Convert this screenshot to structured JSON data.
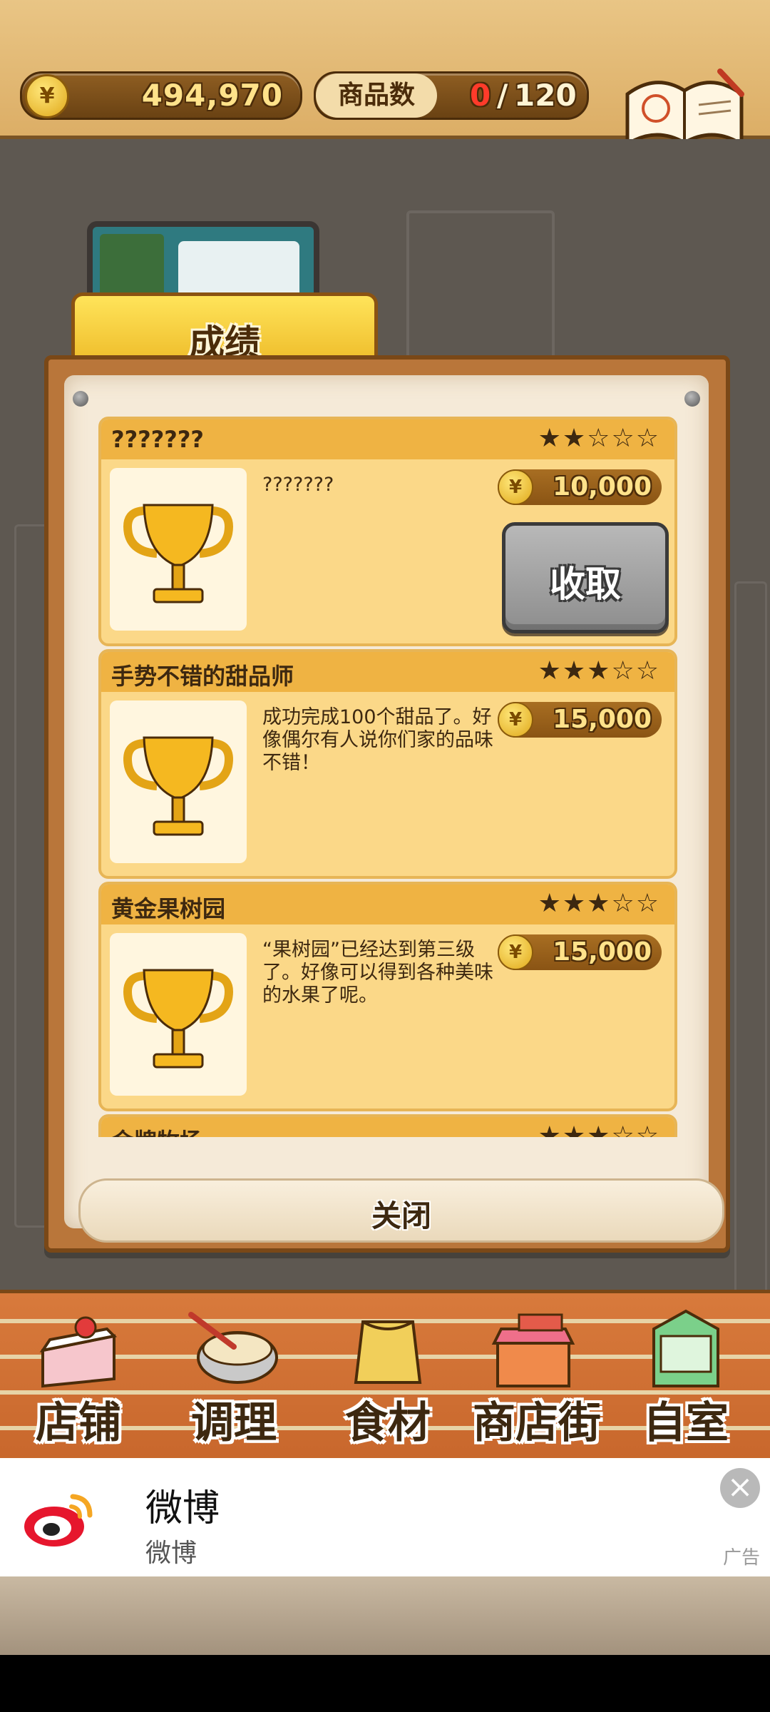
{
  "topbar": {
    "money_icon": "¥",
    "money": "494,970",
    "count_label": "商品数",
    "count_current": "0",
    "count_separator": "/",
    "count_max": "120",
    "recipe_label": "食谱",
    "recipe_icon": "recipe-book-icon"
  },
  "dialog": {
    "tab_title": "成绩",
    "close_label": "关闭",
    "achievements": [
      {
        "title": "???????",
        "stars": "★★☆☆☆",
        "rating": 2,
        "description": "???????",
        "reward_icon": "¥",
        "reward": "10,000",
        "claim_label": "收取",
        "icon": "trophy-icon"
      },
      {
        "title": "手势不错的甜品师",
        "stars": "★★★☆☆",
        "rating": 3,
        "description": "成功完成100个甜品了。好像偶尔有人说你们家的品味不错！",
        "reward_icon": "¥",
        "reward": "15,000",
        "icon": "trophy-icon"
      },
      {
        "title": "黄金果树园",
        "stars": "★★★☆☆",
        "rating": 3,
        "description": "“果树园”已经达到第三级了。好像可以得到各种美味的水果了呢。",
        "reward_icon": "¥",
        "reward": "15,000",
        "icon": "trophy-icon"
      },
      {
        "title": "金牌牧场",
        "stars": "★★★☆☆",
        "rating": 3
      }
    ]
  },
  "nav": {
    "items": [
      {
        "label": "店铺",
        "icon": "cake-icon"
      },
      {
        "label": "调理",
        "icon": "mixing-bowl-icon"
      },
      {
        "label": "食材",
        "icon": "flour-bag-icon"
      },
      {
        "label": "商店街",
        "icon": "shop-street-icon"
      },
      {
        "label": "自室",
        "icon": "staff-only-door-icon"
      }
    ]
  },
  "ad": {
    "title": "微博",
    "subtitle": "微博",
    "tag": "广告",
    "close_icon": "×",
    "brand_color": "#e6162d"
  }
}
